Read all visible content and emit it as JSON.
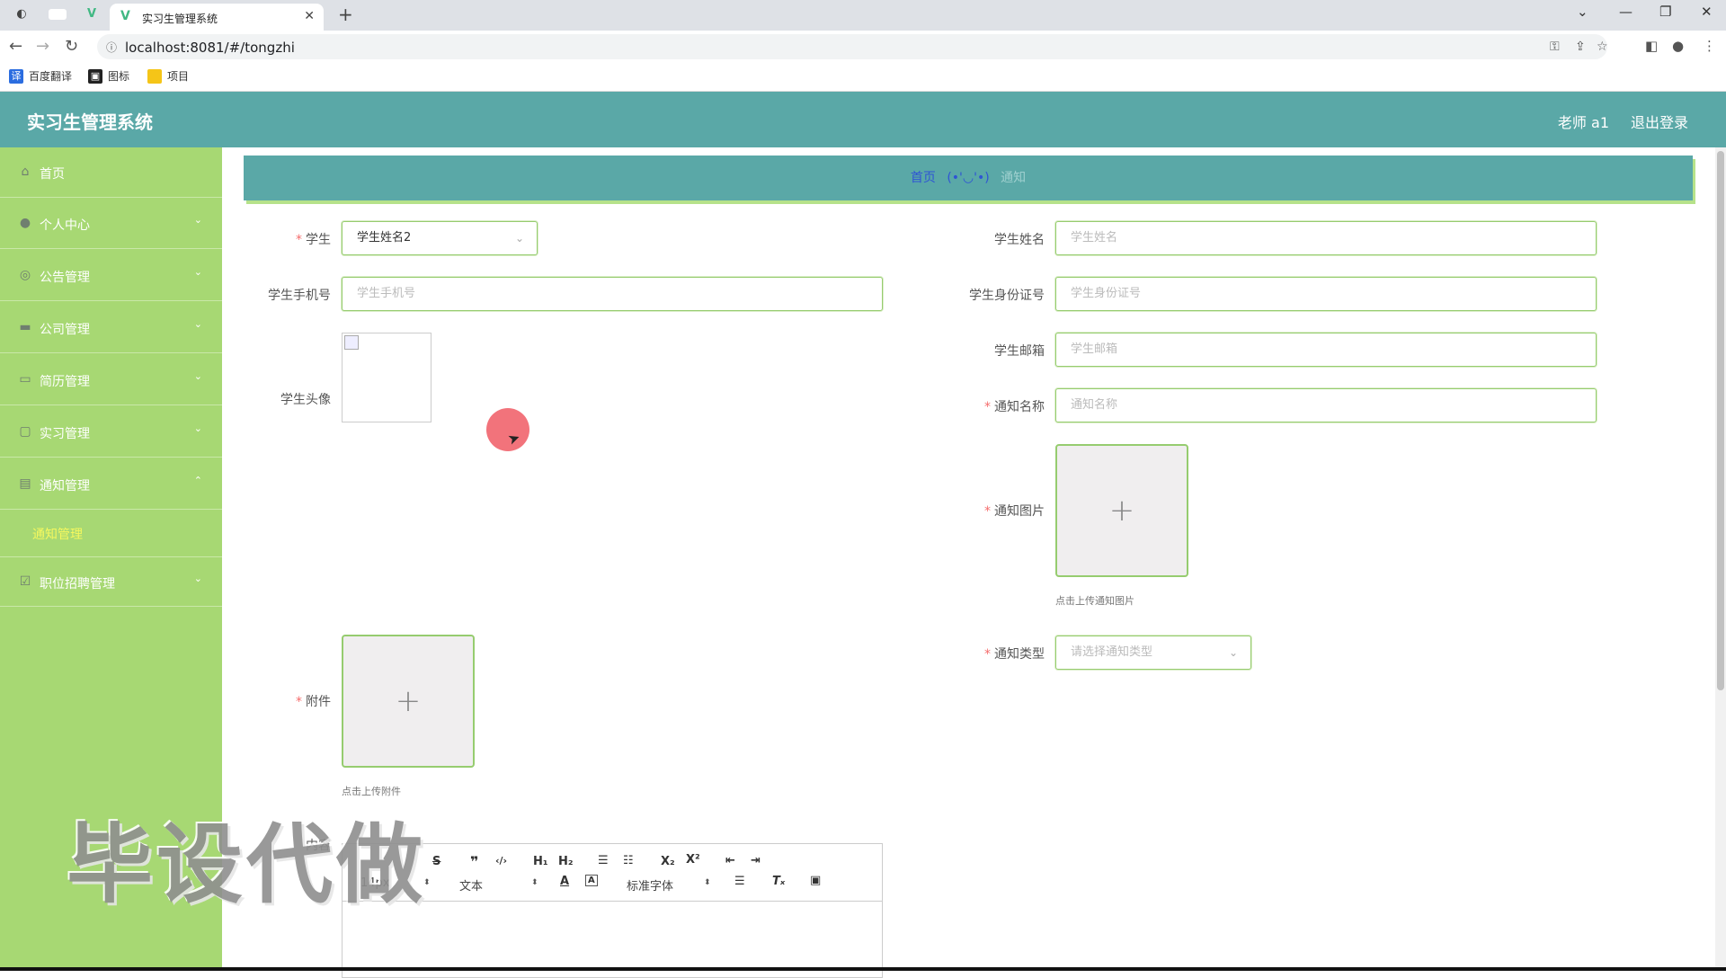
{
  "browser": {
    "tab_title": "实习生管理系统",
    "url": "localhost:8081/#/tongzhi",
    "bookmarks": [
      {
        "label": "百度翻译",
        "icon": "translate-icon",
        "color": "#2b6de0"
      },
      {
        "label": "图标",
        "icon": "image-icon",
        "color": "#222222"
      },
      {
        "label": "项目",
        "icon": "folder-icon",
        "color": "#f5c518"
      }
    ]
  },
  "header": {
    "title": "实习生管理系统",
    "user": "老师 a1",
    "logout": "退出登录",
    "bg_color": "#5aa8a7"
  },
  "sidebar": {
    "bg_color": "#a7d873",
    "items": [
      {
        "label": "首页",
        "icon": "home-icon"
      },
      {
        "label": "个人中心",
        "icon": "user-icon",
        "expandable": true
      },
      {
        "label": "公告管理",
        "icon": "bell-icon",
        "expandable": true
      },
      {
        "label": "公司管理",
        "icon": "building-icon",
        "expandable": true
      },
      {
        "label": "简历管理",
        "icon": "monitor-icon",
        "expandable": true
      },
      {
        "label": "实习管理",
        "icon": "chat-icon",
        "expandable": true
      },
      {
        "label": "通知管理",
        "icon": "briefcase-icon",
        "expanded": true,
        "children": [
          "通知管理"
        ]
      },
      {
        "label": "职位招聘管理",
        "icon": "checkbox-icon",
        "expandable": true
      }
    ],
    "active_sub_color": "#f5f85e"
  },
  "breadcrumb": {
    "home": "首页",
    "separator": "(•'◡'•)",
    "current": "通知"
  },
  "form": {
    "student": {
      "label": "学生",
      "required": true,
      "value": "学生姓名2"
    },
    "student_name": {
      "label": "学生姓名",
      "placeholder": "学生姓名"
    },
    "student_phone": {
      "label": "学生手机号",
      "placeholder": "学生手机号"
    },
    "student_id_card": {
      "label": "学生身份证号",
      "placeholder": "学生身份证号"
    },
    "student_avatar": {
      "label": "学生头像"
    },
    "student_email": {
      "label": "学生邮箱",
      "placeholder": "学生邮箱"
    },
    "notice_name": {
      "label": "通知名称",
      "required": true,
      "placeholder": "通知名称"
    },
    "notice_image": {
      "label": "通知图片",
      "required": true,
      "hint": "点击上传通知图片"
    },
    "notice_type": {
      "label": "通知类型",
      "required": true,
      "placeholder": "请选择通知类型"
    },
    "attachment": {
      "label": "附件",
      "required": true,
      "hint": "点击上传附件"
    },
    "content": {
      "label": "内容"
    }
  },
  "editor": {
    "toolbar_buttons": [
      "S",
      "❞",
      "‹/›",
      "H1",
      "H2",
      "ordered-list",
      "bullet-list",
      "X₂",
      "X²",
      "outdent",
      "indent"
    ],
    "size_select": "14px",
    "header_select": "文本",
    "font_select": "标准字体"
  },
  "watermark": "毕设代做"
}
